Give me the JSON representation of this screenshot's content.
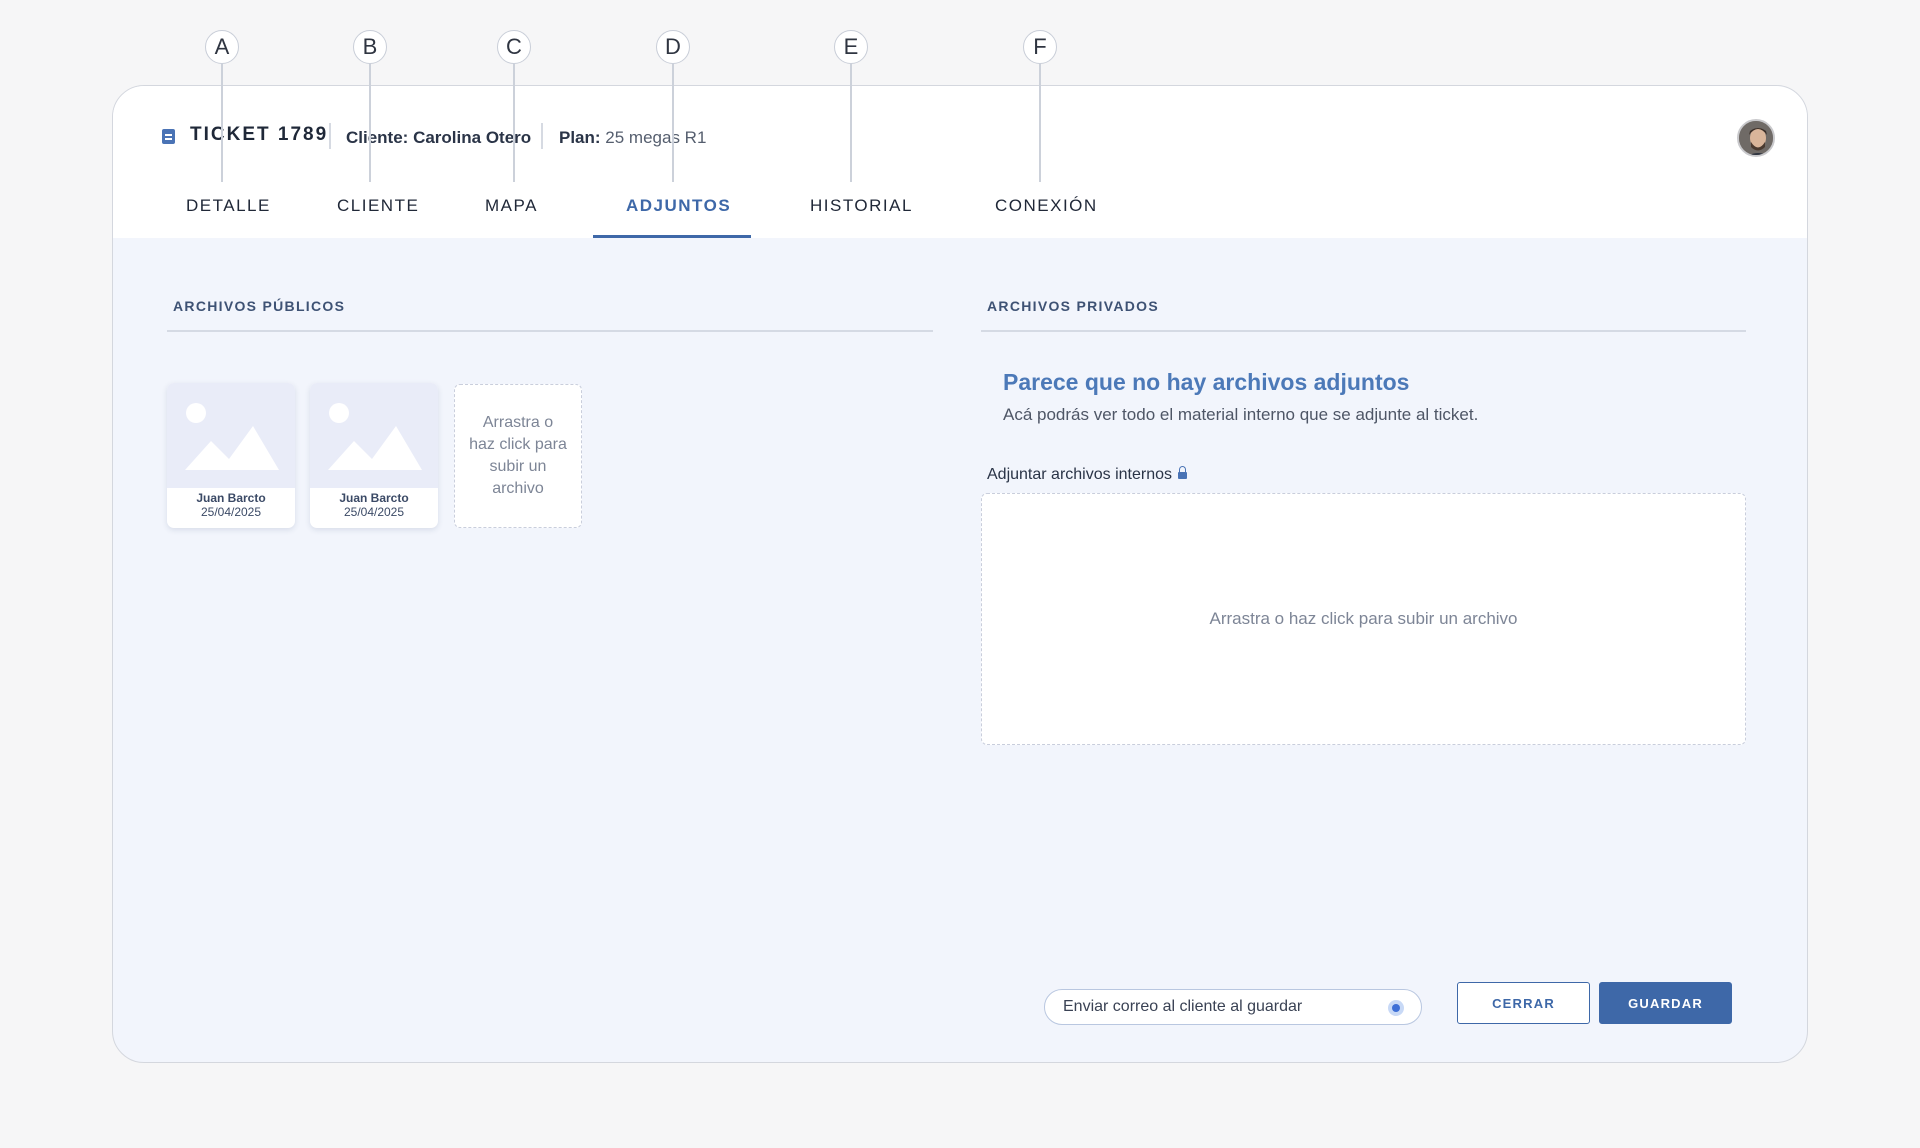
{
  "annotations": [
    "A",
    "B",
    "C",
    "D",
    "E",
    "F"
  ],
  "header": {
    "ticket_title": "TICKET 1789",
    "client_label": "Cliente:",
    "client_name": "Carolina Otero",
    "plan_label": "Plan:",
    "plan_value": "25 megas R1"
  },
  "tabs": [
    {
      "label": "DETALLE",
      "active": false
    },
    {
      "label": "CLIENTE",
      "active": false
    },
    {
      "label": "MAPA",
      "active": false
    },
    {
      "label": "ADJUNTOS",
      "active": true
    },
    {
      "label": "HISTORIAL",
      "active": false
    },
    {
      "label": "CONEXIÓN",
      "active": false
    }
  ],
  "public_files": {
    "title": "ARCHIVOS PÚBLICOS",
    "files": [
      {
        "author": "Juan Barcto",
        "date": "25/04/2025"
      },
      {
        "author": "Juan Barcto",
        "date": "25/04/2025"
      }
    ],
    "upload_text": "Arrastra o haz click para subir un archivo"
  },
  "private_files": {
    "title": "ARCHIVOS PRIVADOS",
    "empty_title": "Parece que no hay archivos adjuntos",
    "empty_subtitle": "Acá podrás ver todo el material interno que se adjunte al ticket.",
    "attach_label": "Adjuntar archivos internos",
    "upload_text": "Arrastra o haz click para subir un archivo"
  },
  "footer": {
    "email_toggle_label": "Enviar correo al cliente al guardar",
    "email_toggle_on": true,
    "close_label": "CERRAR",
    "save_label": "GUARDAR"
  },
  "colors": {
    "accent": "#3e68a8",
    "empty_title": "#4c79b8",
    "card_body": "#f2f5fc"
  }
}
